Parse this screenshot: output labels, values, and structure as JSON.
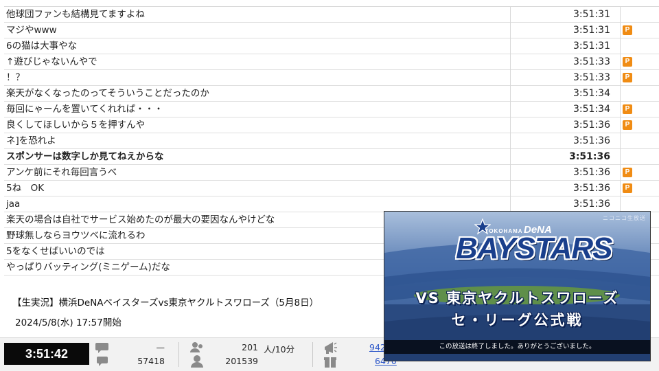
{
  "comments": [
    {
      "text": "他球団ファンも結構見てますよね",
      "time": "3:51:31",
      "premium": false,
      "bold": false
    },
    {
      "text": "マジやwww",
      "time": "3:51:31",
      "premium": true,
      "bold": false
    },
    {
      "text": "6の猫は大事やな",
      "time": "3:51:31",
      "premium": false,
      "bold": false
    },
    {
      "text": "↑遊びじゃないんやで",
      "time": "3:51:33",
      "premium": true,
      "bold": false
    },
    {
      "text": "！？",
      "time": "3:51:33",
      "premium": true,
      "bold": false
    },
    {
      "text": "楽天がなくなったのってそういうことだったのか",
      "time": "3:51:34",
      "premium": false,
      "bold": false
    },
    {
      "text": "毎回にゃーんを置いてくれれば・・・",
      "time": "3:51:34",
      "premium": true,
      "bold": false
    },
    {
      "text": "良くしてほしいから５を押すんや",
      "time": "3:51:36",
      "premium": true,
      "bold": false
    },
    {
      "text": "ネ]を恐れよ",
      "time": "3:51:36",
      "premium": false,
      "bold": false
    },
    {
      "text": "スポンサーは数字しか見てねえからな",
      "time": "3:51:36",
      "premium": false,
      "bold": true
    },
    {
      "text": "アンケ前にそれ毎回言うべ",
      "time": "3:51:36",
      "premium": true,
      "bold": false
    },
    {
      "text": "5ね　OK",
      "time": "3:51:36",
      "premium": true,
      "bold": false
    },
    {
      "text": "jaa",
      "time": "3:51:36",
      "premium": false,
      "bold": false
    },
    {
      "text": "楽天の場合は自社でサービス始めたのが最大の要因なんやけどな",
      "time": "",
      "premium": false,
      "bold": false
    },
    {
      "text": "野球無しならヨウツベに流れるわ",
      "time": "",
      "premium": false,
      "bold": false
    },
    {
      "text": "5をなくせばいいのでは",
      "time": "",
      "premium": false,
      "bold": false
    },
    {
      "text": "やっぱりバッティング(ミニゲーム)だな",
      "time": "",
      "premium": false,
      "bold": false
    }
  ],
  "premium_badge": "P",
  "program": {
    "title": "【生実況】横浜DeNAベイスターズvs東京ヤクルトスワローズ（5月8日）",
    "start": "2024/5/8(水) 17:57開始"
  },
  "status": {
    "elapsed": "3:51:42",
    "comments_top": "—",
    "comments_total": "57418",
    "viewers_rate": "201",
    "viewers_unit": "人/10分",
    "viewers_total": "201539",
    "ad_points": "942",
    "gift_points": "6470"
  },
  "video": {
    "watermark": "ニコニコ生放送",
    "team_small": "YOKOHAMA",
    "team_sponsor": "DeNA",
    "team_name": "BAYSTARS",
    "vs_line": "VS 東京ヤクルトスワローズ",
    "league_line": "セ・リーグ公式戦",
    "ended_message": "この放送は終了しました。ありがとうございました。"
  },
  "icons": {
    "comment": "comment-icon",
    "viewer": "viewer-icon",
    "ad": "ad-megaphone-icon",
    "gift": "gift-icon"
  },
  "colors": {
    "premium": "#f08c14",
    "link": "#2a55c8",
    "timer_bg": "#0a0a0a",
    "team_blue": "#1a3f8c"
  }
}
